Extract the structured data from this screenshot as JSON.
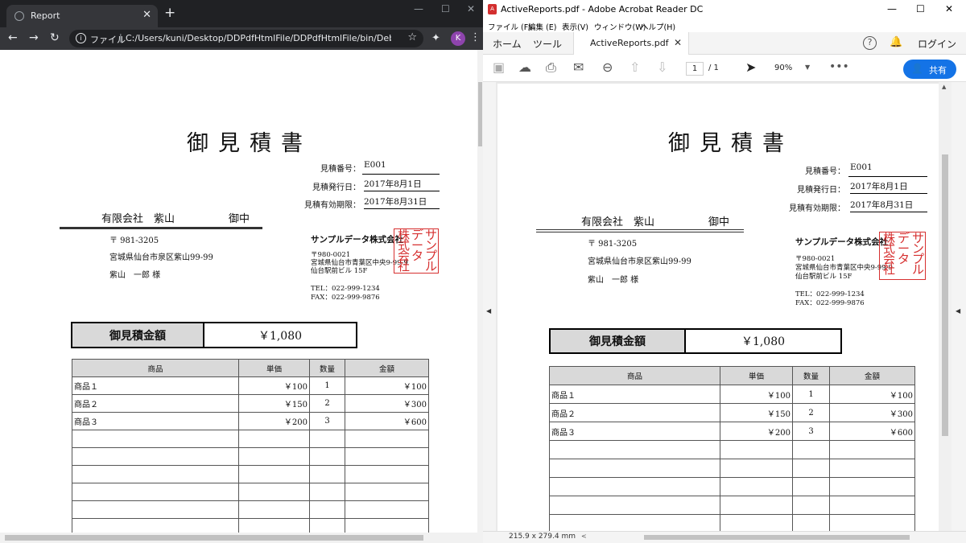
{
  "chrome": {
    "tab_title": "Report",
    "url_scheme": "ファイル",
    "url": "C:/Users/kuni/Desktop/DDPdfHtmlFile/DDPdfHtmlFile/bin/Debug/n...",
    "avatar_letter": "K"
  },
  "acrobat": {
    "window_title": "ActiveReports.pdf - Adobe Acrobat Reader DC",
    "menu": [
      "ファイル (F)",
      "編集 (E)",
      "表示(V)",
      "ウィンドウ(W)",
      "ヘルプ(H)"
    ],
    "tabs": {
      "home": "ホーム",
      "tools": "ツール",
      "doc": "ActiveReports.pdf"
    },
    "login": "ログイン",
    "page_current": "1",
    "page_total": "/ 1",
    "zoom": "90%",
    "share": "共有",
    "page_size": "215.9 x 279.4 mm"
  },
  "report": {
    "title": "御見積書",
    "meta": [
      {
        "label": "見積番号：",
        "value": "E001"
      },
      {
        "label": "見積発行日：",
        "value": "2017年8月1日"
      },
      {
        "label": "見積有効期限：",
        "value": "2017年8月31日"
      }
    ],
    "customer": {
      "name": "有限会社　紫山",
      "honorific": "御中",
      "postal": "〒 981-3205",
      "address": "宮城県仙台市泉区紫山99-99",
      "person": "紫山　一郎 様"
    },
    "company": {
      "name": "サンプルデータ株式会社",
      "postal": "〒980-0021",
      "address1": "宮城県仙台市青葉区中央9-99-9",
      "address2": "仙台駅前ビル 15F",
      "tel": "TEL：022-999-1234",
      "fax": "FAX：022-999-9876",
      "stamp_cols": [
        "サンプル",
        "データ",
        "株式会社"
      ]
    },
    "total_label": "御見積金額",
    "total_value": "￥1,080",
    "table": {
      "headers": [
        "商品",
        "単価",
        "数量",
        "金額"
      ],
      "rows": [
        [
          "商品１",
          "￥100",
          "1",
          "￥100"
        ],
        [
          "商品２",
          "￥150",
          "2",
          "￥300"
        ],
        [
          "商品３",
          "￥200",
          "3",
          "￥600"
        ]
      ]
    }
  }
}
